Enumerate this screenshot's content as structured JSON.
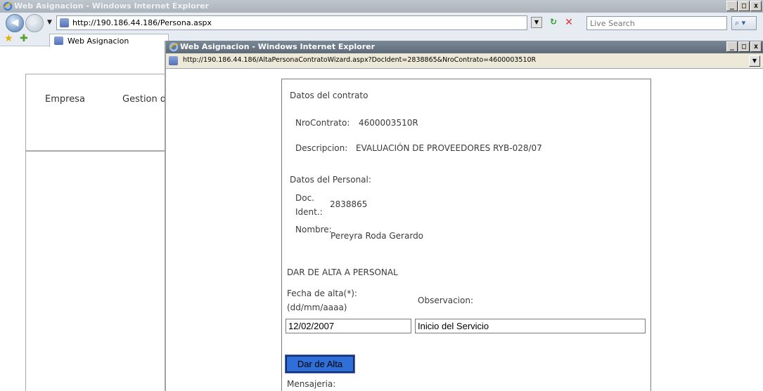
{
  "main_window": {
    "title": "Web Asignacion - Windows Internet Explorer",
    "address": "http://190.186.44.186/Persona.aspx",
    "search_placeholder": "Live Search",
    "tab_label": "Web Asignacion",
    "controls": {
      "minimize": "_",
      "maximize": "□",
      "close": "x"
    }
  },
  "background_page": {
    "menu_items": [
      "Empresa",
      "Gestion d"
    ]
  },
  "popup_window": {
    "title": "Web Asignacion - Windows Internet Explorer",
    "address": "http://190.186.44.186/AltaPersonaContratoWizard.aspx?DocIdent=2838865&NroContrato=4600003510R",
    "controls": {
      "minimize": "_",
      "maximize": "□",
      "close": "x"
    }
  },
  "form": {
    "contract_section_title": "Datos del contrato",
    "contract_number_label": "NroContrato:",
    "contract_number": "4600003510R",
    "description_label": "Descripcion:",
    "description": "EVALUACIÓN DE PROVEEDORES RYB-028/07",
    "personal_section_title": "Datos del Personal:",
    "doc_label_line1": "Doc.",
    "doc_label_line2": "Ident.:",
    "doc_value": "2838865",
    "name_label": "Nombre:",
    "name_value": "Pereyra Roda Gerardo",
    "alta_section_title": "DAR DE ALTA A PERSONAL",
    "date_label_line1": "Fecha de alta(*):",
    "date_label_line2": "(dd/mm/aaaa)",
    "observation_label": "Observacion:",
    "date_value": "12/02/2007",
    "observation_value": "Inicio del Servicio",
    "submit_label": "Dar de Alta",
    "messages_label": "Mensajeria:"
  },
  "colors": {
    "submit_button": "#2f6fd8",
    "titlebar_active": "#5f6b78"
  }
}
